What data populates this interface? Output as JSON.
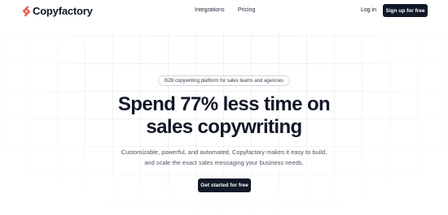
{
  "brand": {
    "name": "Copyfactory",
    "logo_icon": "copyfactory-logo-icon",
    "accent": "#e8604c"
  },
  "nav": {
    "integrations": "Integrations",
    "pricing": "Pricing"
  },
  "auth": {
    "login": "Log in",
    "signup": "Sign up for free"
  },
  "hero": {
    "badge": "B2B copywriting platform for sales teams and agencies",
    "headline_line1": "Spend 77% less time on",
    "headline_line2": "sales copywriting",
    "sub_line1": "Customizable, powerful, and automated, Copyfactory makes it easy to build,",
    "sub_line2": "and scale the exact sales messaging your business needs.",
    "cta": "Get started for free"
  },
  "colors": {
    "primary_dark": "#111827",
    "background": "#ffffff",
    "text_muted": "#4b5563"
  }
}
